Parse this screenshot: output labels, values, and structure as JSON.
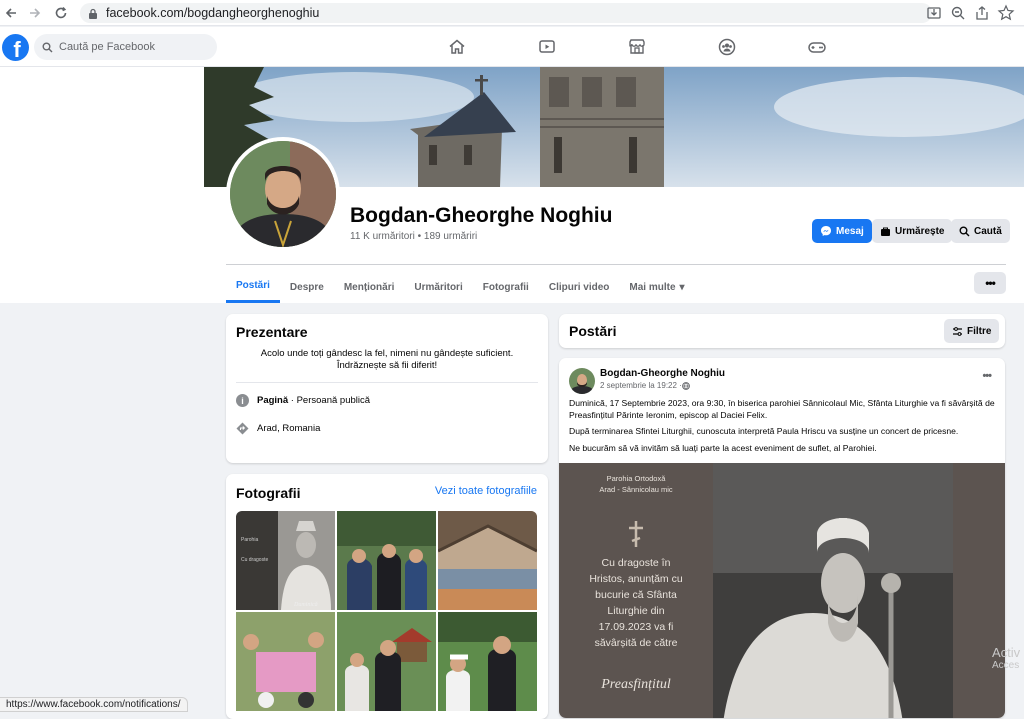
{
  "browser": {
    "url": "facebook.com/bogdangheorghenoghiu",
    "status_url": "https://www.facebook.com/notifications/"
  },
  "facebook": {
    "search_placeholder": "Caută pe Facebook",
    "logo": "f"
  },
  "profile": {
    "name": "Bogdan-Gheorghe Noghiu",
    "stats": "11 K urmăritori • 189 urmăriri",
    "buttons": {
      "message": "Mesaj",
      "follow": "Urmărește",
      "search": "Caută"
    },
    "tabs": [
      "Postări",
      "Despre",
      "Menționări",
      "Urmăritori",
      "Fotografii",
      "Clipuri video",
      "Mai multe"
    ],
    "active_tab": "Postări"
  },
  "intro": {
    "title": "Prezentare",
    "bio": "Acolo unde toți gândesc la fel, nimeni nu gândește suficient. Îndrăznește să fii diferit!",
    "page_label": "Pagină",
    "page_category": " · Persoană publică",
    "location": "Arad, Romania"
  },
  "photos": {
    "title": "Fotografii",
    "see_all": "Vezi toate fotografiile"
  },
  "posts": {
    "title": "Postări",
    "filters": "Filtre",
    "post": {
      "author": "Bogdan-Gheorghe Noghiu",
      "date": "2 septembrie la 19:22 · ",
      "p1": "Duminică, 17 Septembrie 2023,  ora 9:30, în biserica parohiei Sânnicolaul Mic, Sfânta Liturghie va fi săvârșită de Preasfințitul Părinte Ieronim, episcop al Daciei Felix.",
      "p2": "După terminarea Sfintei Liturghii, cunoscuta interpretă Paula Hriscu va susține un concert de pricesne.",
      "p3": "Ne bucurăm să vă invităm să luați parte la acest eveniment de suflet, al Parohiei.",
      "poster": {
        "parish1": "Parohia Ortodoxă",
        "parish2": "Arad - Sânnicolau mic",
        "text": "Cu dragoste în Hristos, anunțăm cu bucurie că Sfânta Liturghie din 17.09.2023 va fi săvârșită de către",
        "signature": "Preasfințitul"
      }
    }
  },
  "watermark": {
    "line1": "Activ",
    "line2": "Acces"
  },
  "colors": {
    "brand": "#1877f2",
    "bg": "#f0f2f5",
    "text": "#050505",
    "muted": "#65676b"
  }
}
